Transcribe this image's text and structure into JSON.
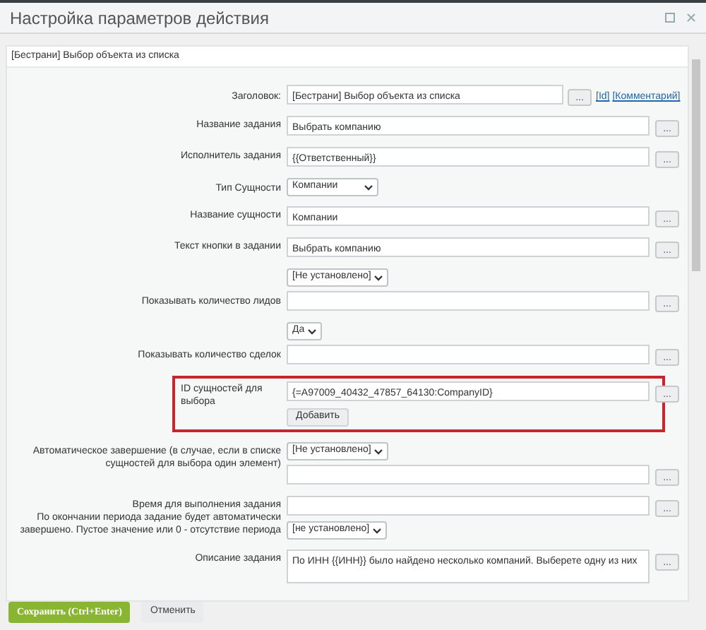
{
  "window": {
    "title": "Настройка параметров действия"
  },
  "panel": {
    "header": "[Бестрани] Выбор объекта из списка"
  },
  "rows": [
    {
      "kind": "title",
      "label": "Заголовок:",
      "value": "[Бестрани] Выбор объекта из списка",
      "button": "...",
      "links": [
        "[Id]",
        "[Комментарий]"
      ]
    },
    {
      "kind": "text",
      "label": "Название задания",
      "value": "Выбрать компанию",
      "button": "..."
    },
    {
      "kind": "text",
      "label": "Исполнитель задания",
      "value": "{{Ответственный}}",
      "button": "..."
    },
    {
      "kind": "select",
      "label": "Тип Сущности",
      "value": "Компании"
    },
    {
      "kind": "text",
      "label": "Название сущности",
      "value": "Компании",
      "button": "..."
    },
    {
      "kind": "text",
      "label": "Текст кнопки в задании",
      "value": "Выбрать компанию",
      "button": "..."
    },
    {
      "kind": "select_text",
      "label": "Показывать количество лидов",
      "select": "[Не установлено]",
      "button": "..."
    },
    {
      "kind": "select_text",
      "label": "Показывать количество сделок",
      "select": "Да",
      "button": "..."
    },
    {
      "kind": "list",
      "label": "ID сущностей для выбора",
      "value": "{=A97009_40432_47857_64130:CompanyID}",
      "button": "...",
      "add": "Добавить",
      "highlighted": true
    },
    {
      "kind": "select_text",
      "label": "Автоматическое завершение (в случае, если в списке сущностей для выбора один элемент)",
      "select": "[Не установлено]",
      "button": "..."
    },
    {
      "kind": "text_select",
      "label": "Время для выполнения задания",
      "hint": "По окончании периода задание будет автоматически завершено. Пустое значение или 0 - отсутствие периода",
      "select": "[не установлено]",
      "button": "..."
    },
    {
      "kind": "textarea",
      "label": "Описание задания",
      "value": "По ИНН {{ИНН}} было найдено несколько компаний. Выберете одну из них",
      "button": "..."
    }
  ],
  "footer": {
    "save": "Сохранить (Ctrl+Enter)",
    "cancel": "Отменить"
  }
}
